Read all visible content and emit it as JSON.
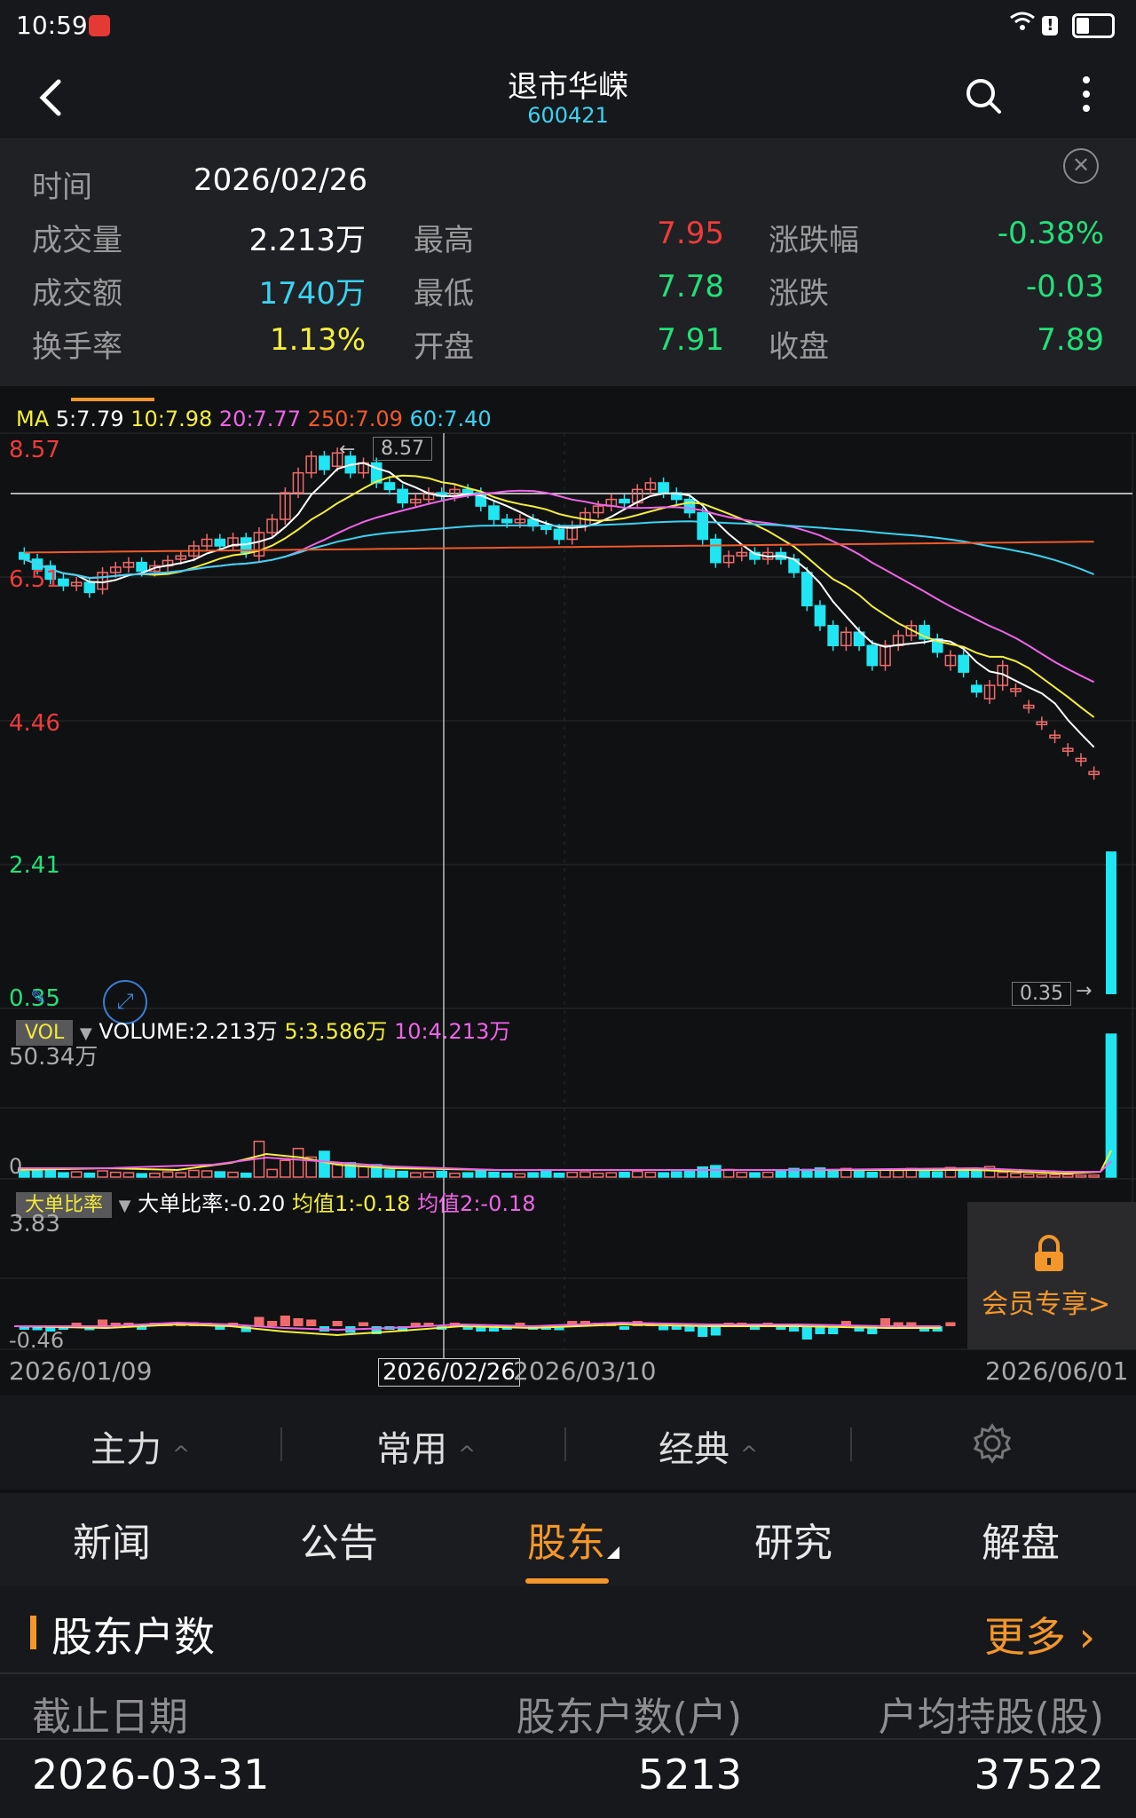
{
  "status_bar": {
    "time": "10:59"
  },
  "header": {
    "title": "退市华嵘",
    "code": "600421"
  },
  "info": {
    "time_label": "时间",
    "time_value": "2026/02/26",
    "rows": [
      {
        "l1": "成交量",
        "v1": "2.213万",
        "l2": "最高",
        "v2": "7.95",
        "l3": "涨跌幅",
        "v3": "-0.38%"
      },
      {
        "l1": "成交额",
        "v1": "1740万",
        "l2": "最低",
        "v2": "7.78",
        "l3": "涨跌",
        "v3": "-0.03"
      },
      {
        "l1": "换手率",
        "v1": "1.13%",
        "l2": "开盘",
        "v2": "7.91",
        "l3": "收盘",
        "v3": "7.89"
      }
    ]
  },
  "ma": {
    "label": "MA",
    "ma5": "5:7.79",
    "ma10": "10:7.98",
    "ma20": "20:7.77",
    "ma250": "250:7.09",
    "ma60": "60:7.40"
  },
  "price_axis": {
    "p1": "8.57",
    "p2": "6.51",
    "p3": "4.46",
    "p4": "2.41",
    "p5": "0.35"
  },
  "callouts": {
    "high": "8.57",
    "low": "0.35"
  },
  "vol": {
    "tag": "VOL",
    "main": "VOLUME:2.213万",
    "v5": "5:3.586万",
    "v10": "10:4.213万",
    "max": "50.34万",
    "zero": "0"
  },
  "big_order": {
    "tag": "大单比率",
    "main": "大单比率:-0.20",
    "avg1": "均值1:-0.18",
    "avg2": "均值2:-0.18",
    "max": "3.83",
    "min": "-0.46"
  },
  "locked": {
    "text": "会员专享>"
  },
  "dates": {
    "d1": "2026/01/09",
    "d2": "2026/02/26",
    "d3": "2026/03/10",
    "d4": "2026/06/01"
  },
  "toolbar": {
    "t1": "主力",
    "t2": "常用",
    "t3": "经典"
  },
  "tabs": {
    "news": "新闻",
    "notice": "公告",
    "holders": "股东",
    "research": "研究",
    "analysis": "解盘"
  },
  "section": {
    "title": "股东户数",
    "more": "更多",
    "headers": [
      "截止日期",
      "股东户数(户)",
      "户均持股(股)"
    ],
    "row": [
      "2026-03-31",
      "5213",
      "37522"
    ]
  },
  "colors": {
    "up": "#ef6b6b",
    "down": "#1fe6f2",
    "ma5": "#ffffff",
    "ma10": "#f4ef3a",
    "ma20": "#ef64e8",
    "ma60": "#3ad3f2",
    "ma250": "#ef5a2a",
    "accent": "#f3972a"
  },
  "chart_data": {
    "type": "candlestick",
    "ylim": [
      0.35,
      8.57
    ],
    "candles": [
      {
        "o": 7.0,
        "c": 6.9
      },
      {
        "o": 6.9,
        "c": 6.75
      },
      {
        "o": 6.8,
        "c": 6.6
      },
      {
        "o": 6.6,
        "c": 6.5
      },
      {
        "o": 6.5,
        "c": 6.55
      },
      {
        "o": 6.55,
        "c": 6.4
      },
      {
        "o": 6.45,
        "c": 6.7
      },
      {
        "o": 6.7,
        "c": 6.78
      },
      {
        "o": 6.78,
        "c": 6.85
      },
      {
        "o": 6.85,
        "c": 6.72
      },
      {
        "o": 6.72,
        "c": 6.8
      },
      {
        "o": 6.8,
        "c": 6.88
      },
      {
        "o": 6.9,
        "c": 6.95
      },
      {
        "o": 6.95,
        "c": 7.1
      },
      {
        "o": 7.1,
        "c": 7.2
      },
      {
        "o": 7.2,
        "c": 7.1
      },
      {
        "o": 7.1,
        "c": 7.22
      },
      {
        "o": 7.22,
        "c": 7.0
      },
      {
        "o": 6.95,
        "c": 7.3
      },
      {
        "o": 7.3,
        "c": 7.5
      },
      {
        "o": 7.5,
        "c": 7.9
      },
      {
        "o": 7.9,
        "c": 8.2
      },
      {
        "o": 8.2,
        "c": 8.45
      },
      {
        "o": 8.45,
        "c": 8.25
      },
      {
        "o": 8.3,
        "c": 8.5
      },
      {
        "o": 8.45,
        "c": 8.2
      },
      {
        "o": 8.2,
        "c": 8.35
      },
      {
        "o": 8.35,
        "c": 8.05
      },
      {
        "o": 8.05,
        "c": 7.95
      },
      {
        "o": 7.95,
        "c": 7.75
      },
      {
        "o": 7.75,
        "c": 7.8
      },
      {
        "o": 7.8,
        "c": 7.9
      },
      {
        "o": 7.9,
        "c": 7.85
      },
      {
        "o": 7.85,
        "c": 7.95
      },
      {
        "o": 7.95,
        "c": 7.9
      },
      {
        "o": 7.9,
        "c": 7.7
      },
      {
        "o": 7.7,
        "c": 7.5
      },
      {
        "o": 7.5,
        "c": 7.45
      },
      {
        "o": 7.45,
        "c": 7.5
      },
      {
        "o": 7.5,
        "c": 7.4
      },
      {
        "o": 7.4,
        "c": 7.35
      },
      {
        "o": 7.35,
        "c": 7.2
      },
      {
        "o": 7.2,
        "c": 7.4
      },
      {
        "o": 7.4,
        "c": 7.6
      },
      {
        "o": 7.6,
        "c": 7.7
      },
      {
        "o": 7.7,
        "c": 7.8
      },
      {
        "o": 7.8,
        "c": 7.75
      },
      {
        "o": 7.75,
        "c": 7.95
      },
      {
        "o": 7.95,
        "c": 8.05
      },
      {
        "o": 8.05,
        "c": 7.9
      },
      {
        "o": 7.9,
        "c": 7.8
      },
      {
        "o": 7.8,
        "c": 7.6
      },
      {
        "o": 7.6,
        "c": 7.2
      },
      {
        "o": 7.2,
        "c": 6.85
      },
      {
        "o": 6.85,
        "c": 6.95
      },
      {
        "o": 6.95,
        "c": 7.0
      },
      {
        "o": 7.0,
        "c": 6.9
      },
      {
        "o": 6.9,
        "c": 7.0
      },
      {
        "o": 7.0,
        "c": 6.9
      },
      {
        "o": 6.9,
        "c": 6.7
      },
      {
        "o": 6.7,
        "c": 6.2
      },
      {
        "o": 6.2,
        "c": 5.9
      },
      {
        "o": 5.9,
        "c": 5.6
      },
      {
        "o": 5.6,
        "c": 5.8
      },
      {
        "o": 5.8,
        "c": 5.6
      },
      {
        "o": 5.6,
        "c": 5.3
      },
      {
        "o": 5.3,
        "c": 5.6
      },
      {
        "o": 5.6,
        "c": 5.75
      },
      {
        "o": 5.75,
        "c": 5.9
      },
      {
        "o": 5.9,
        "c": 5.7
      },
      {
        "o": 5.7,
        "c": 5.5
      },
      {
        "o": 5.3,
        "c": 5.45
      },
      {
        "o": 5.45,
        "c": 5.2
      },
      {
        "o": 5.0,
        "c": 4.9
      },
      {
        "o": 4.8,
        "c": 5.0
      },
      {
        "o": 5.0,
        "c": 5.3
      },
      {
        "o": 4.95,
        "c": 4.95
      },
      {
        "o": 4.7,
        "c": 4.7
      },
      {
        "o": 4.45,
        "c": 4.45
      },
      {
        "o": 4.25,
        "c": 4.25
      },
      {
        "o": 4.05,
        "c": 4.05
      },
      {
        "o": 3.9,
        "c": 3.9
      },
      {
        "o": 3.7,
        "c": 3.7
      }
    ],
    "last_spike": {
      "o": 2.5,
      "c": 0.35
    },
    "volumes": [
      1.2,
      1.6,
      1.4,
      0.9,
      1.1,
      0.8,
      1.3,
      1.0,
      0.9,
      0.7,
      0.8,
      1.1,
      0.9,
      1.4,
      1.3,
      1.1,
      1.0,
      0.8,
      7.5,
      1.6,
      3.5,
      6.0,
      4.2,
      5.4,
      2.8,
      3.0,
      2.2,
      2.6,
      1.5,
      1.2,
      0.9,
      1.0,
      1.2,
      0.8,
      0.9,
      1.4,
      1.0,
      0.8,
      0.7,
      0.9,
      1.2,
      0.8,
      1.0,
      1.1,
      0.8,
      0.9,
      1.0,
      1.2,
      1.0,
      0.9,
      1.1,
      1.3,
      2.1,
      2.4,
      1.6,
      1.0,
      0.9,
      1.0,
      1.2,
      1.8,
      1.6,
      1.9,
      1.5,
      1.8,
      1.2,
      1.0,
      1.6,
      1.4,
      1.8,
      1.3,
      1.1,
      2.0,
      1.4,
      1.6,
      2.2,
      1.0,
      0.8,
      0.6,
      0.5,
      0.5,
      0.5,
      0.4,
      0.4,
      30
    ]
  }
}
